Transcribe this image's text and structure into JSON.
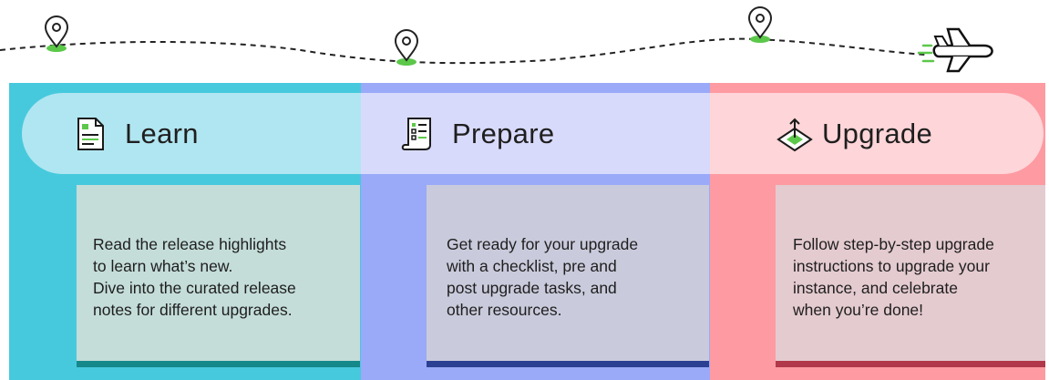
{
  "colors": {
    "learn_bg": "#47c9dd",
    "prepare_bg": "#9aaaf8",
    "upgrade_bg": "#fe9aa1",
    "accent_green": "#5cc84a"
  },
  "journey": {
    "icons": [
      "map-pin-icon",
      "map-pin-icon",
      "map-pin-icon",
      "airplane-icon"
    ]
  },
  "steps": [
    {
      "label": "Learn",
      "icon": "document-icon",
      "lines": [
        "Read the release highlights",
        "to learn what’s new.",
        "Dive into the curated release",
        "notes for different upgrades."
      ]
    },
    {
      "label": "Prepare",
      "icon": "checklist-icon",
      "lines": [
        "Get ready for your upgrade",
        "with a checklist, pre and",
        "post upgrade tasks, and",
        "other resources."
      ]
    },
    {
      "label": "Upgrade",
      "icon": "upgrade-arrow-icon",
      "lines": [
        "Follow step-by-step upgrade",
        "instructions to upgrade your",
        "instance, and celebrate",
        "when you’re done!"
      ]
    }
  ]
}
